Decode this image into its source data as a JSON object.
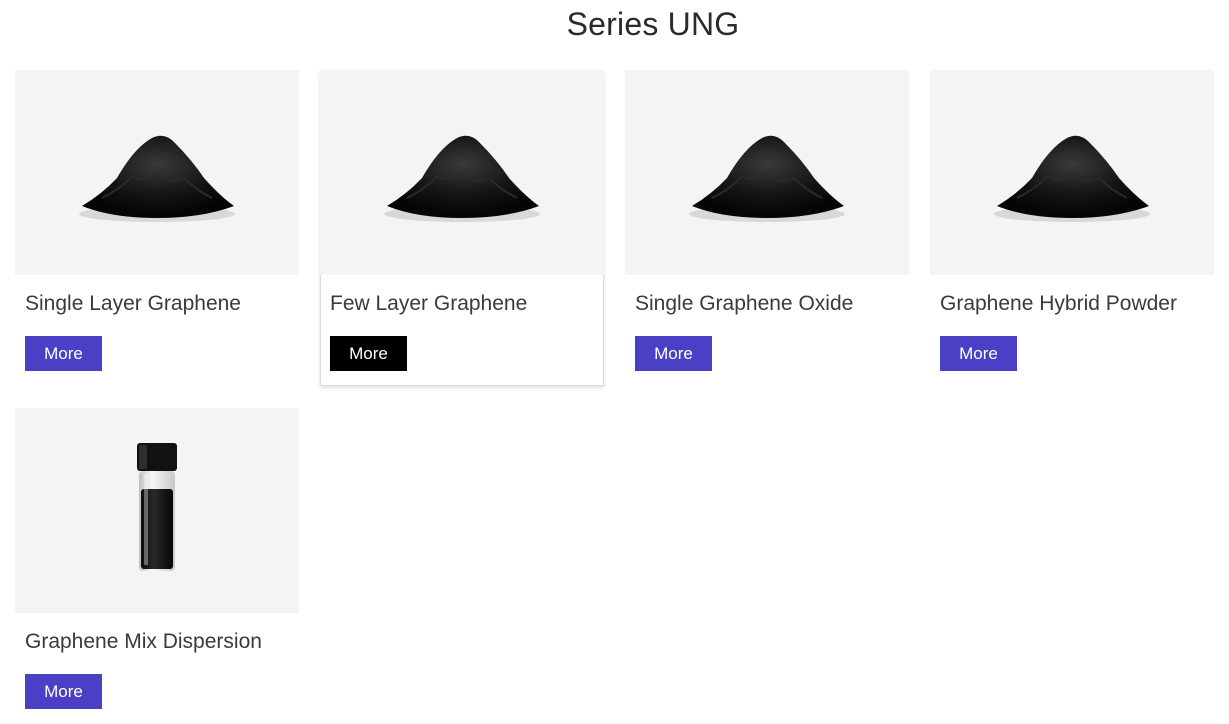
{
  "page": {
    "title": "Series UNG"
  },
  "products": [
    {
      "name": "Single Layer Graphene",
      "button": "More",
      "image": "graphene-powder-pile",
      "state": "default"
    },
    {
      "name": "Few Layer Graphene",
      "button": "More",
      "image": "graphene-powder-pile",
      "state": "hover"
    },
    {
      "name": "Single Graphene Oxide",
      "button": "More",
      "image": "graphene-powder-pile",
      "state": "default"
    },
    {
      "name": "Graphene Hybrid Powder",
      "button": "More",
      "image": "graphene-powder-pile",
      "state": "default"
    },
    {
      "name": "Graphene Mix Dispersion",
      "button": "More",
      "image": "dispersion-vial",
      "state": "default"
    }
  ],
  "colors": {
    "button": "#4a3fc5",
    "button_hover": "#000000",
    "thumb_bg": "#f4f4f4"
  }
}
